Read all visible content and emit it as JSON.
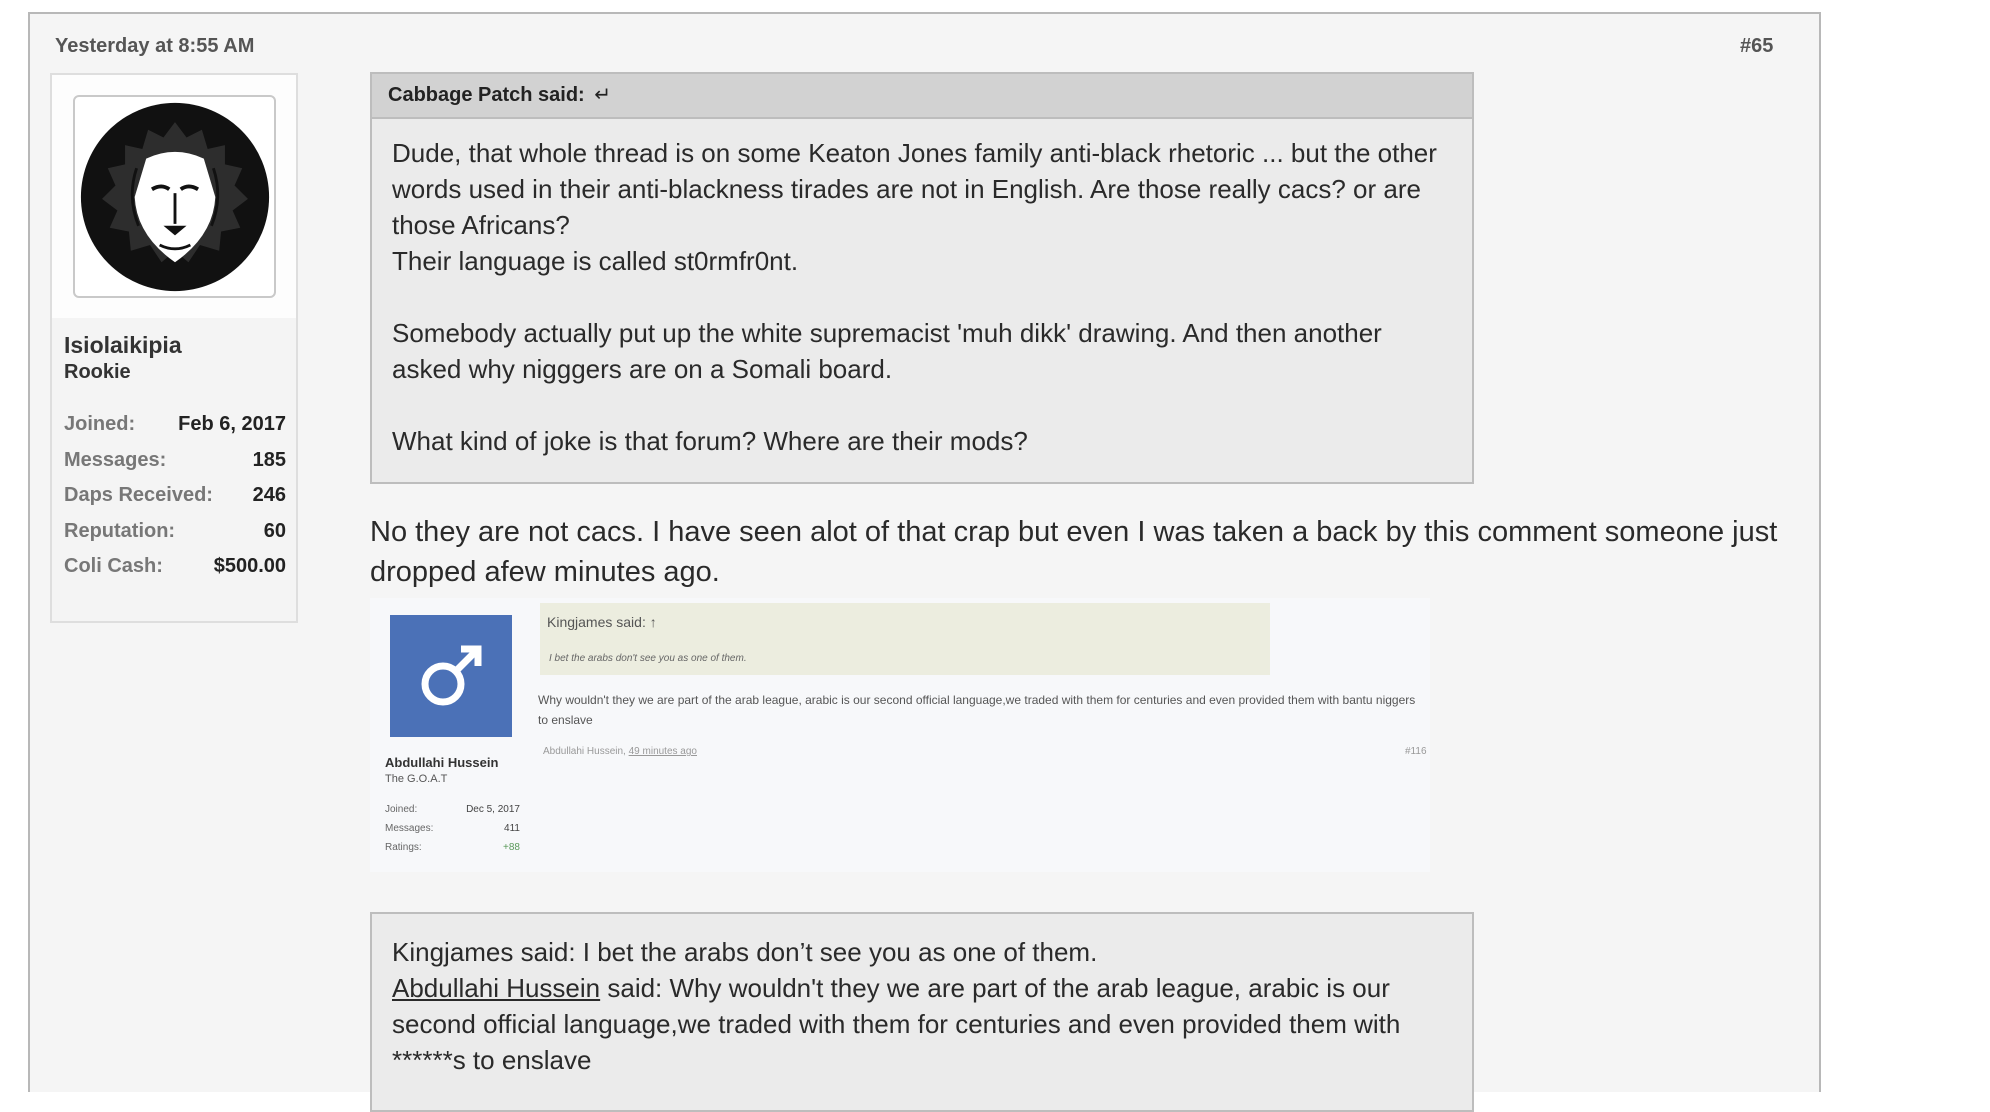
{
  "post": {
    "timestamp": "Yesterday at 8:55 AM",
    "number": "#65"
  },
  "user": {
    "name": "Isiolaikipia",
    "title": "Rookie",
    "avatar_icon": "lion-head-icon",
    "stats": [
      {
        "label": "Joined:",
        "value": "Feb 6, 2017"
      },
      {
        "label": "Messages:",
        "value": "185"
      },
      {
        "label": "Daps Received:",
        "value": "246"
      },
      {
        "label": "Reputation:",
        "value": "60"
      },
      {
        "label": "Coli Cash:",
        "value": "$500.00"
      }
    ]
  },
  "quote": {
    "author": "Cabbage Patch said:",
    "jump_icon": "return-arrow-icon",
    "jump_glyph": "↵",
    "lines": [
      "Dude, that whole thread is on some Keaton Jones family anti-black rhetoric ... but the other words used in their anti-blackness tirades are not in English. Are those really cacs? or are those Africans?",
      "Their language is called st0rmfr0nt.",
      "Somebody actually put up the white supremacist 'muh dikk' drawing. And then another asked why nigggers are on a Somali board.",
      "What kind of joke is that forum? Where are their mods?"
    ]
  },
  "reply": {
    "text": "No they are not cacs. I have seen alot of that crap but even I was taken a back by this comment someone just dropped afew minutes ago."
  },
  "screenshot": {
    "avatar_icon": "male-symbol-icon",
    "avatar_glyph": "♂",
    "name": "Abdullahi Hussein",
    "title": "The G.O.A.T",
    "stats": [
      {
        "label": "Joined:",
        "value": "Dec 5, 2017"
      },
      {
        "label": "Messages:",
        "value": "411"
      },
      {
        "label": "Ratings:",
        "value": "+88"
      }
    ],
    "quote_author": "Kingjames said: ↑",
    "quote_text": "I bet the arabs don't see you as one of them.",
    "body": "Why wouldn't they we are part of the arab league, arabic is our second official language,we traded with them for centuries and even provided them with bantu niggers to enslave",
    "footer_author": "Abdullahi Hussein,",
    "footer_time": "49 minutes ago",
    "number": "#116"
  },
  "transcript": {
    "line1": "Kingjames said: I bet the arabs don’t see you as one of them.",
    "link": "Abdullahi Hussein",
    "line2": " said: Why wouldn't they we are part of the arab league, arabic is our second official language,we traded with them for centuries and even provided them with ******s to enslave"
  },
  "colors": {
    "quote_header_bg": "#d2d2d2",
    "quote_bg": "#ebebeb",
    "screenshot_avatar_bg": "#4b71b7"
  }
}
